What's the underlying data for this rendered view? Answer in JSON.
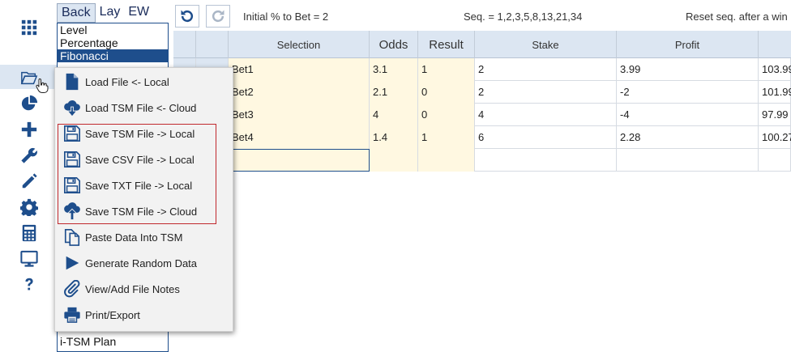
{
  "method_tabs": [
    "Back",
    "Lay",
    "EW"
  ],
  "method_list": [
    "Level",
    "Percentage",
    "Fibonacci"
  ],
  "plan_label": "i-TSM Plan",
  "toolbar": {
    "initial_pct": "Initial % to Bet = 2",
    "sequence": "Seq. = 1,2,3,5,8,13,21,34",
    "reset": "Reset seq. after a win"
  },
  "grid": {
    "columns": [
      "Selection",
      "Odds",
      "Result",
      "Stake",
      "Profit"
    ],
    "rows": [
      {
        "selection": "Bet1",
        "odds": "3.1",
        "result": "1",
        "stake": "2",
        "profit": "3.99",
        "bank": "103.99"
      },
      {
        "selection": "Bet2",
        "odds": "2.1",
        "result": "0",
        "stake": "2",
        "profit": "-2",
        "bank": "101.99"
      },
      {
        "selection": "Bet3",
        "odds": "4",
        "result": "0",
        "stake": "4",
        "profit": "-4",
        "bank": "97.99"
      },
      {
        "selection": "Bet4",
        "odds": "1.4",
        "result": "1",
        "stake": "6",
        "profit": "2.28",
        "bank": "100.27"
      }
    ]
  },
  "menu": [
    {
      "label": "Load File <- Local",
      "icon": "file-icon"
    },
    {
      "label": "Load TSM File <- Cloud",
      "icon": "cloud-download-icon"
    },
    {
      "label": "Save TSM File -> Local",
      "icon": "floppy-disk-icon"
    },
    {
      "label": "Save CSV File -> Local",
      "icon": "floppy-disk-icon"
    },
    {
      "label": "Save TXT File -> Local",
      "icon": "floppy-disk-icon"
    },
    {
      "label": "Save TSM File -> Cloud",
      "icon": "cloud-upload-icon"
    },
    {
      "label": "Paste Data Into TSM",
      "icon": "paste-icon"
    },
    {
      "label": "Generate Random Data",
      "icon": "play-icon"
    },
    {
      "label": "View/Add File Notes",
      "icon": "paperclip-icon"
    },
    {
      "label": "Print/Export",
      "icon": "printer-icon"
    }
  ],
  "colors": {
    "accent": "#1e4e8c",
    "header_bg": "#dce6f2",
    "icon": "#1e4e8c",
    "yellow_cell": "#fff8e1",
    "save_group_border": "#c0282d"
  }
}
